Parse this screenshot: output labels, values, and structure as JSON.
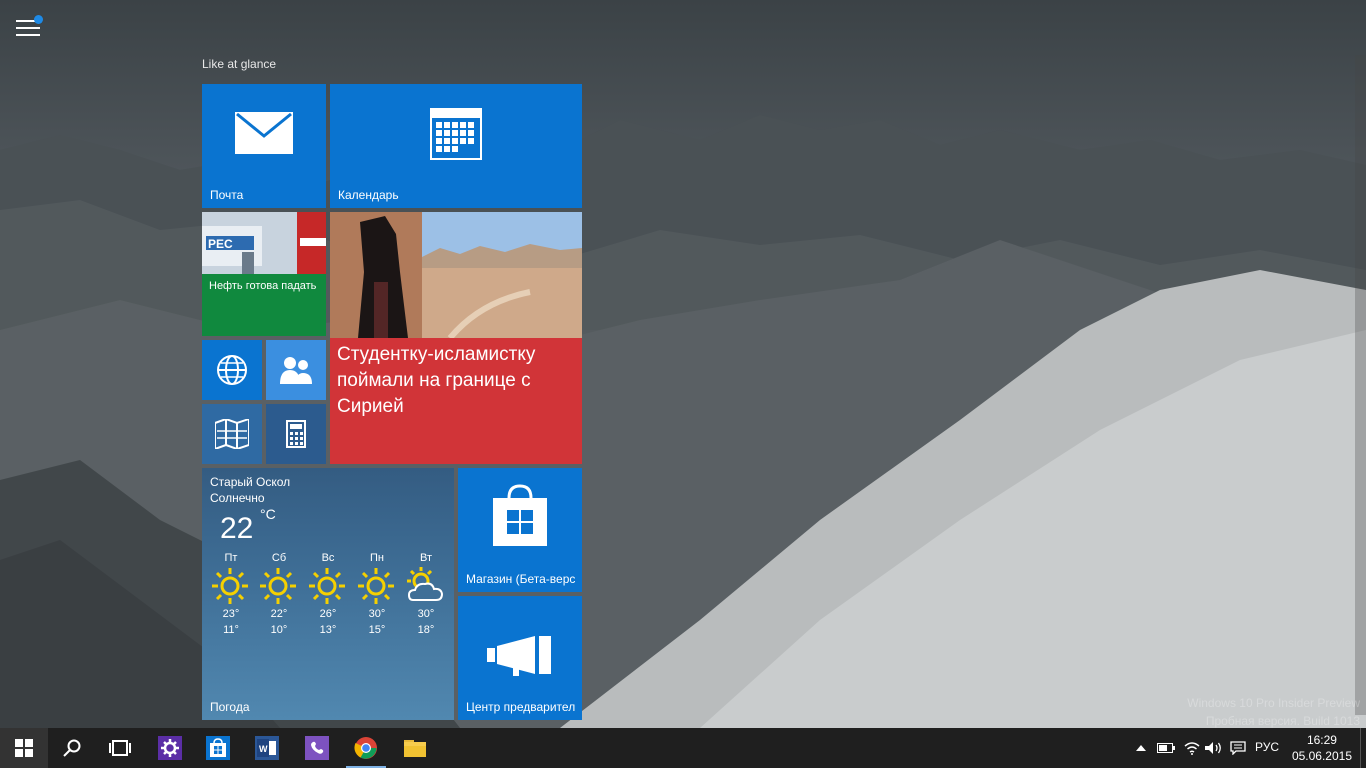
{
  "start_menu": {
    "group_title": "Like at glance",
    "tiles": {
      "mail": {
        "label": "Почта"
      },
      "calendar": {
        "label": "Календарь"
      },
      "money": {
        "label": "Нефть готова падать"
      },
      "news": {
        "headline": "Студентку-исламистку поймали на границе с Сирией"
      },
      "store": {
        "label": "Магазин (Бета-верс"
      },
      "insider": {
        "label": "Центр предварител"
      }
    },
    "weather": {
      "city": "Старый Оскол",
      "condition": "Солнечно",
      "temp": "22",
      "unit": "°C",
      "label": "Погода",
      "forecast": [
        {
          "day": "Пт",
          "high": "23°",
          "low": "11°",
          "icon": "sun-icon"
        },
        {
          "day": "Сб",
          "high": "22°",
          "low": "10°",
          "icon": "sun-icon"
        },
        {
          "day": "Вс",
          "high": "26°",
          "low": "13°",
          "icon": "sun-icon"
        },
        {
          "day": "Пн",
          "high": "30°",
          "low": "15°",
          "icon": "sun-icon"
        },
        {
          "day": "Вт",
          "high": "30°",
          "low": "18°",
          "icon": "partly-cloudy-icon"
        }
      ]
    }
  },
  "watermark": {
    "line1": "Windows 10 Pro Insider Preview",
    "line2": "Пробная версия. Build 1013"
  },
  "taskbar": {
    "language": "РУС",
    "time": "16:29",
    "date": "05.06.2015"
  },
  "colors": {
    "tile_blue": "#0a74d0",
    "money_green": "#10893e",
    "news_red": "#d13438",
    "taskbar": "#1f1f1f"
  }
}
